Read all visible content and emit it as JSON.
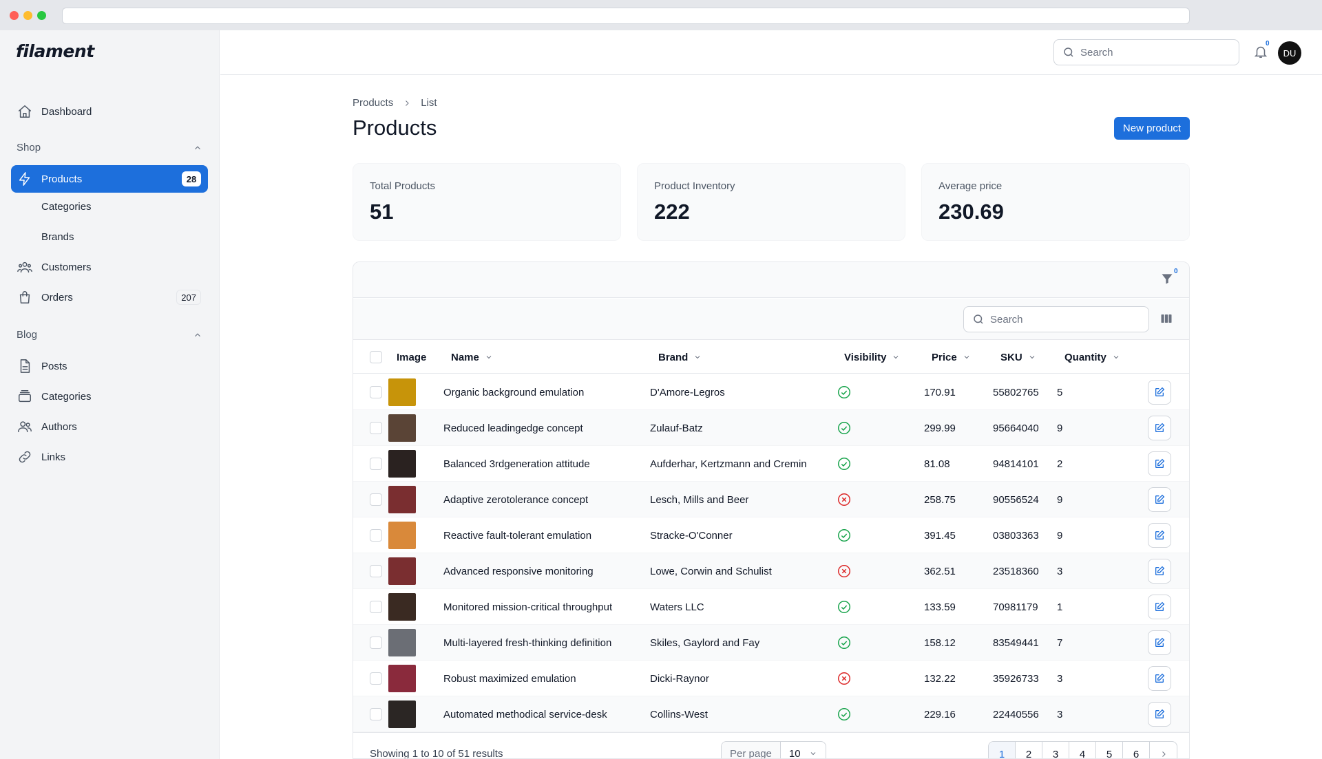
{
  "search": {
    "placeholder": "Search"
  },
  "sidebar": {
    "logo": "filament",
    "dashboard": "Dashboard",
    "shop_label": "Shop",
    "products": "Products",
    "products_count": "28",
    "categories": "Categories",
    "brands": "Brands",
    "customers": "Customers",
    "orders": "Orders",
    "orders_count": "207",
    "blog_label": "Blog",
    "posts": "Posts",
    "blog_categories": "Categories",
    "authors": "Authors",
    "links": "Links"
  },
  "topbar": {
    "notifications_count": "0",
    "avatar_initials": "DU"
  },
  "breadcrumb": {
    "root": "Products",
    "current": "List"
  },
  "page": {
    "title": "Products",
    "new_button": "New product"
  },
  "stats": [
    {
      "label": "Total Products",
      "value": "51"
    },
    {
      "label": "Product Inventory",
      "value": "222"
    },
    {
      "label": "Average price",
      "value": "230.69"
    }
  ],
  "table": {
    "filter_count": "0",
    "search_placeholder": "Search",
    "columns": {
      "image": "Image",
      "name": "Name",
      "brand": "Brand",
      "visibility": "Visibility",
      "price": "Price",
      "sku": "SKU",
      "quantity": "Quantity"
    },
    "rows": [
      {
        "name": "Organic background emulation",
        "brand": "D'Amore-Legros",
        "visible": true,
        "price": "170.91",
        "sku": "55802765",
        "quantity": "5",
        "thumb_color": "#c7940a"
      },
      {
        "name": "Reduced leadingedge concept",
        "brand": "Zulauf-Batz",
        "visible": true,
        "price": "299.99",
        "sku": "95664040",
        "quantity": "9",
        "thumb_color": "#5a4436"
      },
      {
        "name": "Balanced 3rdgeneration attitude",
        "brand": "Aufderhar, Kertzmann and Cremin",
        "visible": true,
        "price": "81.08",
        "sku": "94814101",
        "quantity": "2",
        "thumb_color": "#2a2220"
      },
      {
        "name": "Adaptive zerotolerance concept",
        "brand": "Lesch, Mills and Beer",
        "visible": false,
        "price": "258.75",
        "sku": "90556524",
        "quantity": "9",
        "thumb_color": "#7a2e30"
      },
      {
        "name": "Reactive fault-tolerant emulation",
        "brand": "Stracke-O'Conner",
        "visible": true,
        "price": "391.45",
        "sku": "03803363",
        "quantity": "9",
        "thumb_color": "#d9893a"
      },
      {
        "name": "Advanced responsive monitoring",
        "brand": "Lowe, Corwin and Schulist",
        "visible": false,
        "price": "362.51",
        "sku": "23518360",
        "quantity": "3",
        "thumb_color": "#7a2e30"
      },
      {
        "name": "Monitored mission-critical throughput",
        "brand": "Waters LLC",
        "visible": true,
        "price": "133.59",
        "sku": "70981179",
        "quantity": "1",
        "thumb_color": "#3a2a22"
      },
      {
        "name": "Multi-layered fresh-thinking definition",
        "brand": "Skiles, Gaylord and Fay",
        "visible": true,
        "price": "158.12",
        "sku": "83549441",
        "quantity": "7",
        "thumb_color": "#6b6e75"
      },
      {
        "name": "Robust maximized emulation",
        "brand": "Dicki-Raynor",
        "visible": false,
        "price": "132.22",
        "sku": "35926733",
        "quantity": "3",
        "thumb_color": "#8a2a3c"
      },
      {
        "name": "Automated methodical service-desk",
        "brand": "Collins-West",
        "visible": true,
        "price": "229.16",
        "sku": "22440556",
        "quantity": "3",
        "thumb_color": "#2b2624"
      }
    ],
    "showing": "Showing 1 to 10 of 51 results",
    "per_page_label": "Per page",
    "per_page_value": "10",
    "pages": [
      "1",
      "2",
      "3",
      "4",
      "5",
      "6"
    ]
  }
}
